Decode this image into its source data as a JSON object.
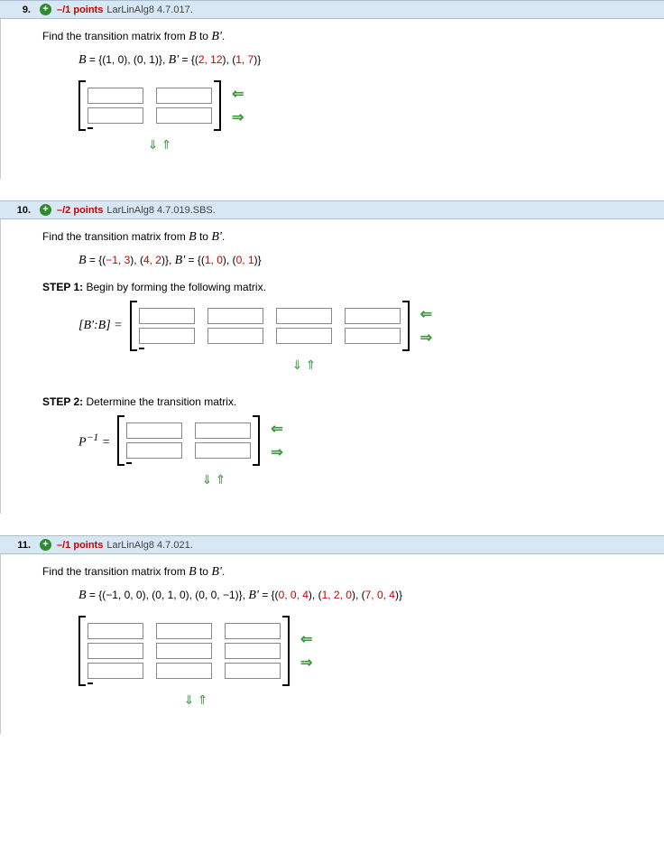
{
  "q9": {
    "number": "9.",
    "points": "–/1 points",
    "ref": "LarLinAlg8 4.7.017.",
    "prompt_a": "Find the transition matrix from ",
    "prompt_b": " to ",
    "basis": "B = {(1, 0), (0, 1)}, B' = {(2, 12), (1, 7)}"
  },
  "q10": {
    "number": "10.",
    "points": "–/2 points",
    "ref": "LarLinAlg8 4.7.019.SBS.",
    "prompt_a": "Find the transition matrix from ",
    "prompt_b": " to ",
    "basis_pre": "B = {(",
    "basis_v1": "−1, 3",
    "basis_mid1": "), (",
    "basis_v2": "4, 2",
    "basis_mid2": ")}, B' = {(",
    "basis_v3": "1, 0",
    "basis_mid3": "), (",
    "basis_v4": "0, 1",
    "basis_end": ")}",
    "step1": "STEP 1:",
    "step1_text": " Begin by forming the following matrix.",
    "step1_label": "[B':B] =",
    "step2": "STEP 2:",
    "step2_text": " Determine the transition matrix.",
    "step2_label": "P⁻¹ ="
  },
  "q11": {
    "number": "11.",
    "points": "–/1 points",
    "ref": "LarLinAlg8 4.7.021.",
    "prompt_a": "Find the transition matrix from ",
    "prompt_b": " to ",
    "basis": "B = {(−1, 0, 0), (0, 1, 0), (0, 0, −1)}, B' = {(0, 0, 4), (1, 2, 0), (7, 0, 4)}"
  },
  "arrows": {
    "left": "⇐",
    "right": "⇒",
    "down": "⇓",
    "up": "⇑"
  }
}
